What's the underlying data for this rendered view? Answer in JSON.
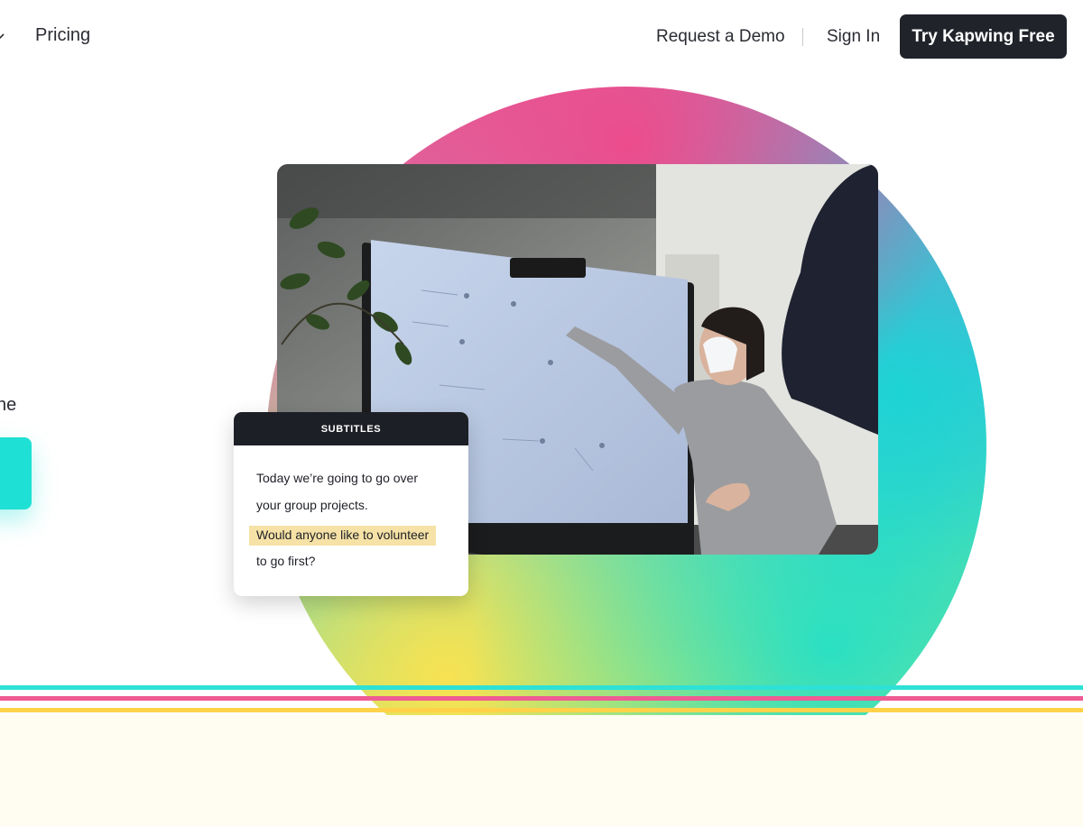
{
  "nav": {
    "pricing_label": "Pricing",
    "demo_label": "Request a Demo",
    "signin_label": "Sign In",
    "cta_label": "Try Kapwing Free"
  },
  "hero": {
    "text_fragment": "ne",
    "colors": {
      "cta_teal": "#1fe0d4",
      "dark": "#21232b"
    }
  },
  "subtitles_card": {
    "header": "SUBTITLES",
    "lines": [
      "Today we’re going to go over",
      "your group projects.",
      "Would anyone like to volunteer",
      "to go first?"
    ],
    "highlight_color": "#f6e2a6"
  },
  "stripes": {
    "colors": [
      "#2ee1d6",
      "#ef5b93",
      "#ffd24a"
    ]
  },
  "icons": [
    "chevron-down-icon"
  ]
}
